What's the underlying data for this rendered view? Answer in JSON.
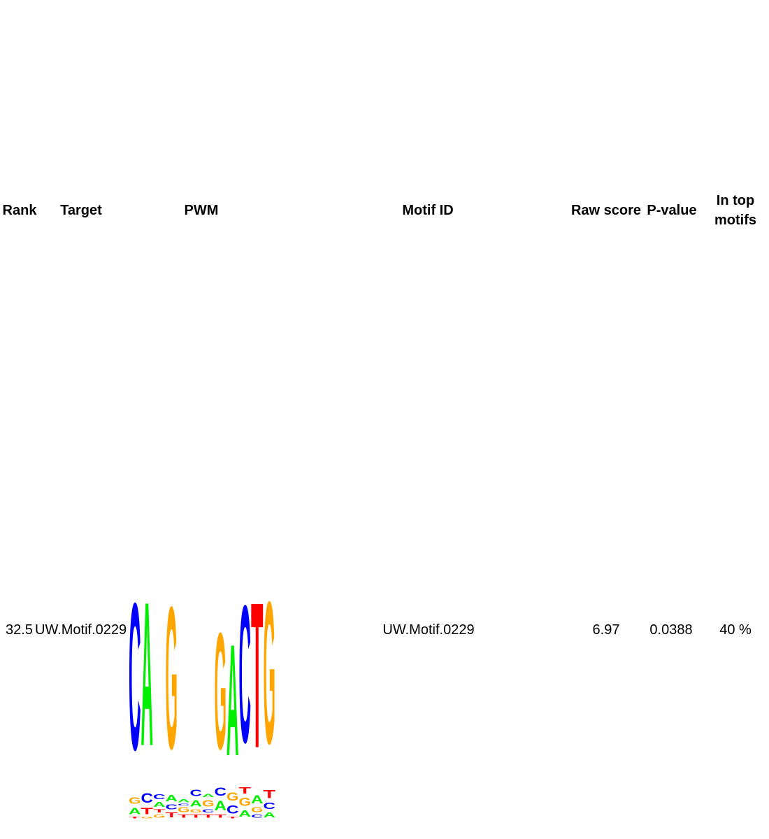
{
  "headers": {
    "rank": "Rank",
    "target": "Target",
    "pwm": "PWM",
    "motif_id": "Motif ID",
    "raw_score": "Raw score",
    "p_value": "P-value",
    "in_top_motifs": "In top motifs"
  },
  "row": {
    "rank": "32.5",
    "target": "UW.Motif.0229",
    "motif_id": "UW.Motif.0229",
    "raw_score": "6.97",
    "p_value": "0.0388",
    "in_top_motifs": "40 %"
  },
  "logo": {
    "colors": {
      "A": "#00ee00",
      "C": "#0000ff",
      "G": "#ffa500",
      "T": "#ff0000"
    },
    "positions": [
      [
        [
          "T",
          0.01
        ],
        [
          "A",
          0.04
        ],
        [
          "G",
          0.04
        ],
        [
          "C",
          0.91
        ]
      ],
      [
        [
          "G",
          0.01
        ],
        [
          "T",
          0.04
        ],
        [
          "C",
          0.06
        ],
        [
          "A",
          0.89
        ]
      ],
      [
        [
          "G",
          0.02
        ],
        [
          "T",
          0.02
        ],
        [
          "A",
          0.03
        ],
        [
          "C",
          0.03
        ]
      ],
      [
        [
          "T",
          0.03
        ],
        [
          "C",
          0.03
        ],
        [
          "A",
          0.04
        ],
        [
          "G",
          0.88
        ]
      ],
      [
        [
          "T",
          0.02
        ],
        [
          "G",
          0.03
        ],
        [
          "C",
          0.01
        ],
        [
          "A",
          0.02
        ]
      ],
      [
        [
          "T",
          0.02
        ],
        [
          "G",
          0.02
        ],
        [
          "A",
          0.04
        ],
        [
          "C",
          0.04
        ]
      ],
      [
        [
          "T",
          0.02
        ],
        [
          "C",
          0.02
        ],
        [
          "G",
          0.04
        ],
        [
          "A",
          0.02
        ]
      ],
      [
        [
          "T",
          0.02
        ],
        [
          "A",
          0.06
        ],
        [
          "C",
          0.05
        ],
        [
          "G",
          0.72
        ]
      ],
      [
        [
          "T",
          0.01
        ],
        [
          "C",
          0.05
        ],
        [
          "G",
          0.05
        ],
        [
          "A",
          0.69
        ]
      ],
      [
        [
          "A",
          0.04
        ],
        [
          "G",
          0.05
        ],
        [
          "T",
          0.04
        ],
        [
          "C",
          0.85
        ]
      ],
      [
        [
          "C",
          0.02
        ],
        [
          "G",
          0.03
        ],
        [
          "A",
          0.05
        ],
        [
          "T",
          0.9
        ]
      ],
      [
        [
          "A",
          0.03
        ],
        [
          "C",
          0.04
        ],
        [
          "T",
          0.05
        ],
        [
          "G",
          0.88
        ]
      ]
    ]
  }
}
